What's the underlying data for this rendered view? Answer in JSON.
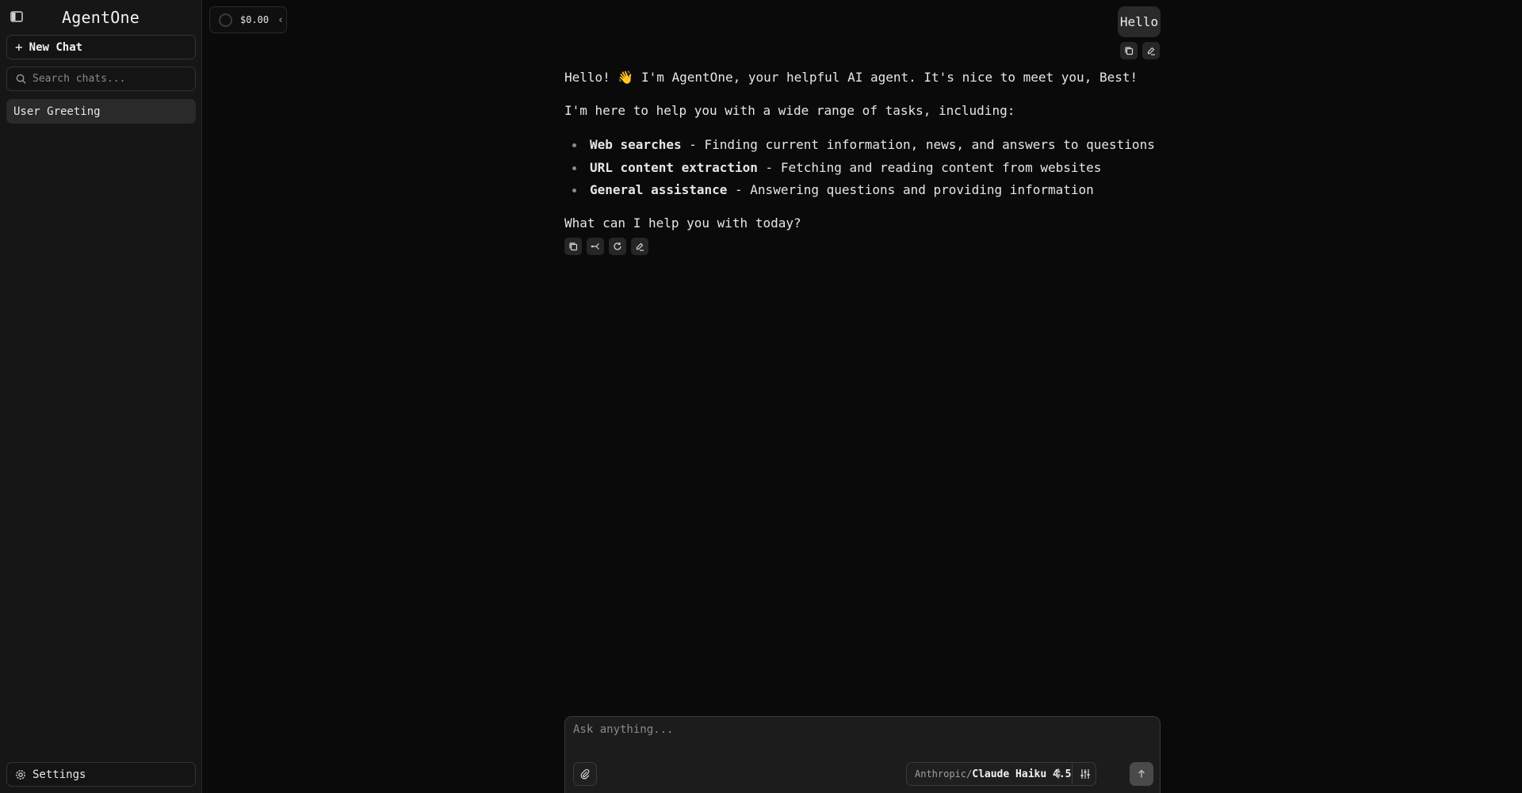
{
  "sidebar": {
    "toggle_icon": "sidebar-toggle-icon",
    "brand": "AgentOne",
    "new_chat_label": "New Chat",
    "search_placeholder": "Search chats...",
    "chats": [
      {
        "label": "User Greeting"
      }
    ],
    "settings_label": "Settings"
  },
  "topbar": {
    "cost": "$0.00"
  },
  "conversation": {
    "user_message": "Hello",
    "assistant": {
      "greeting": "Hello! 👋 I'm AgentOne, your helpful AI agent. It's nice to meet you, Best!",
      "intro": "I'm here to help you with a wide range of tasks, including:",
      "items": [
        {
          "title": "Web searches",
          "desc": " - Finding current information, news, and answers to questions"
        },
        {
          "title": "URL content extraction",
          "desc": " - Fetching and reading content from websites"
        },
        {
          "title": "General assistance",
          "desc": " - Answering questions and providing information"
        }
      ],
      "closing": "What can I help you with today?"
    }
  },
  "composer": {
    "placeholder": "Ask anything...",
    "model_provider": "Anthropic/",
    "model_name": "Claude Haiku 4.5"
  },
  "colors": {
    "background": "#0a0a0a",
    "sidebar": "#161616",
    "bubble": "#2a2a2a"
  }
}
